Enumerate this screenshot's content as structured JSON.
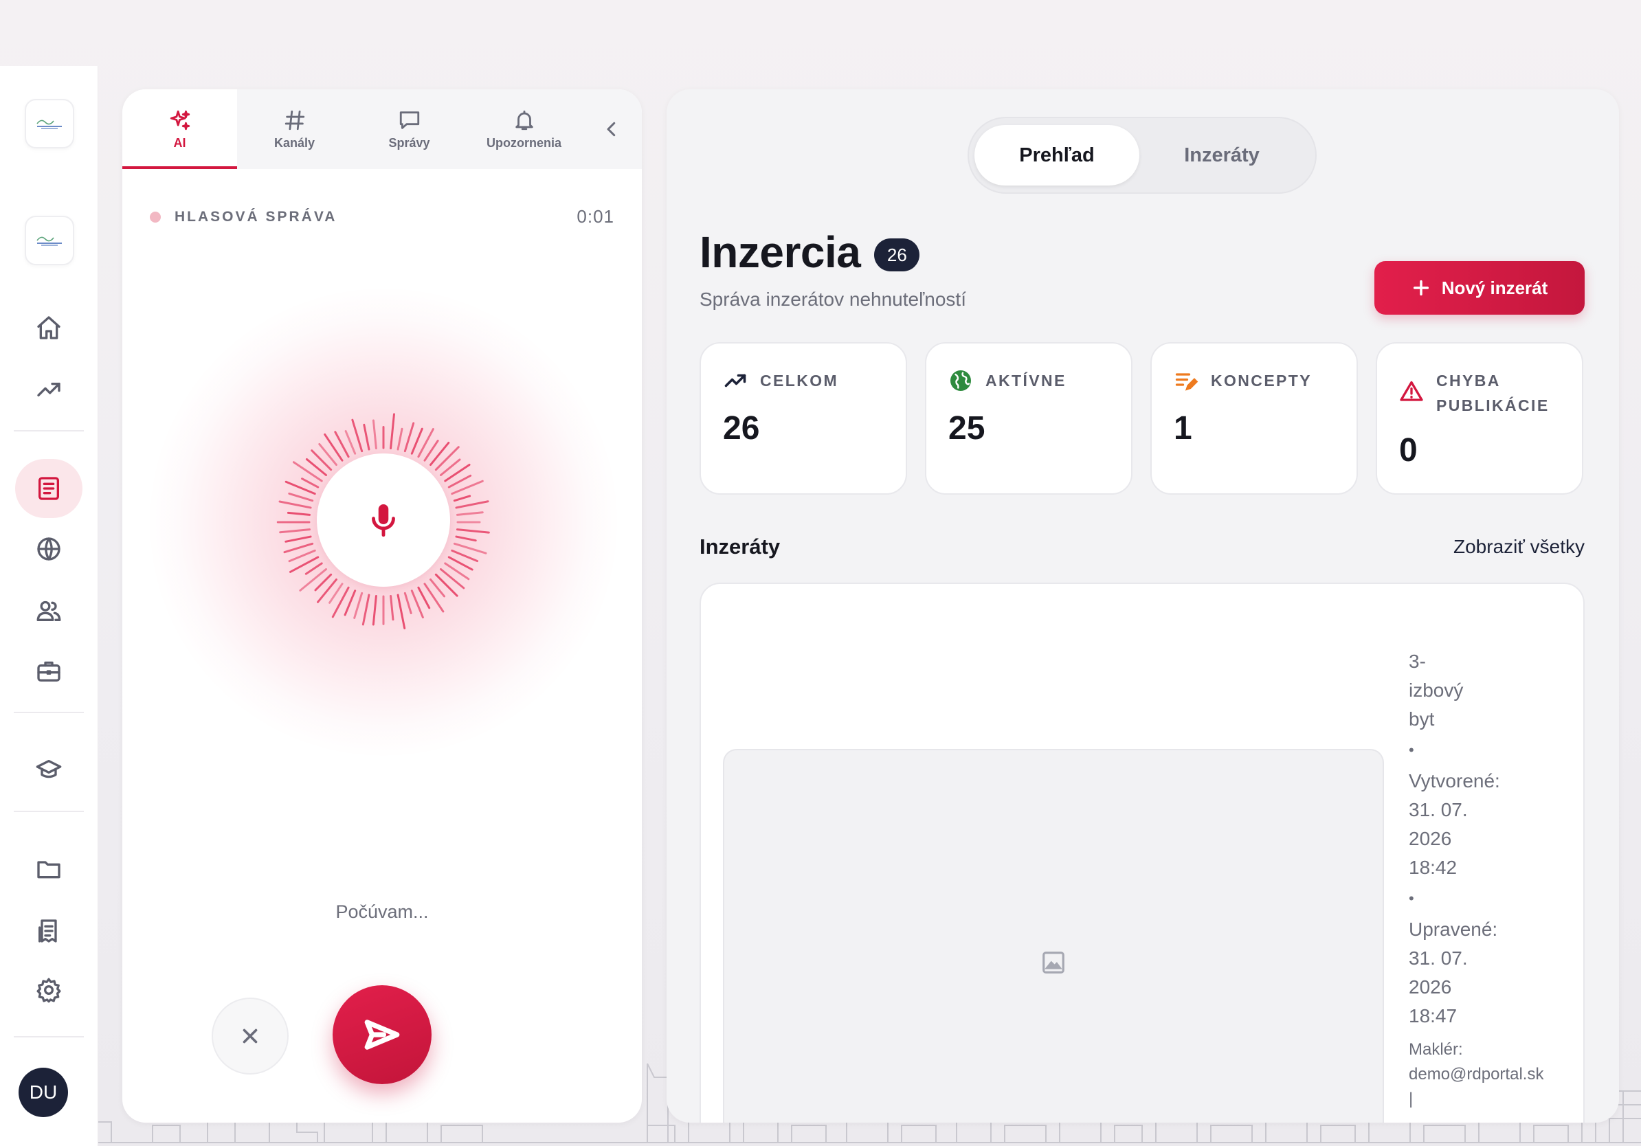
{
  "colors": {
    "accent": "#d3173f",
    "navy": "#1c2238",
    "muted": "#6c6e7a"
  },
  "rail": {
    "avatar": "DU",
    "icons": [
      "home-icon",
      "trending-icon",
      "listings-icon",
      "globe-icon",
      "users-icon",
      "briefcase-icon",
      "graduation-cap-icon",
      "folder-icon",
      "receipt-icon",
      "settings-icon"
    ]
  },
  "chat": {
    "tabs": [
      {
        "label": "AI",
        "icon": "sparkles-icon"
      },
      {
        "label": "Kanály",
        "icon": "hash-icon"
      },
      {
        "label": "Správy",
        "icon": "message-icon"
      },
      {
        "label": "Upozornenia",
        "icon": "bell-icon"
      }
    ],
    "voice_label": "HLASOVÁ SPRÁVA",
    "voice_time": "0:01",
    "status": "Počúvam..."
  },
  "main": {
    "segments": [
      "Prehľad",
      "Inzeráty"
    ],
    "title": "Inzercia",
    "count": "26",
    "subtitle": "Správa inzerátov nehnuteľností",
    "new_button": "Nový inzerát",
    "stats": [
      {
        "label": "CELKOM",
        "value": "26",
        "icon": "trend-up-icon"
      },
      {
        "label": "AKTÍVNE",
        "value": "25",
        "icon": "globe-filled-icon"
      },
      {
        "label": "KONCEPTY",
        "value": "1",
        "icon": "draft-edit-icon"
      },
      {
        "label_1": "CHYBA",
        "label_2": "PUBLIKÁCIE",
        "value": "0",
        "icon": "warning-icon"
      }
    ],
    "section_title": "Inzeráty",
    "section_link": "Zobraziť všetky",
    "listing": {
      "type_1": "3-",
      "type_2": "izbový",
      "type_3": "byt",
      "created_label": "Vytvorené:",
      "created_date_1": "31. 07.",
      "created_date_2": "2026",
      "created_time": "18:42",
      "updated_label": "Upravené:",
      "updated_date_1": "31. 07.",
      "updated_date_2": "2026",
      "updated_time": "18:47",
      "agent_label": "Maklér:",
      "agent_email": "demo@rdportal.sk",
      "bullet": "•",
      "pipe": "|"
    }
  }
}
